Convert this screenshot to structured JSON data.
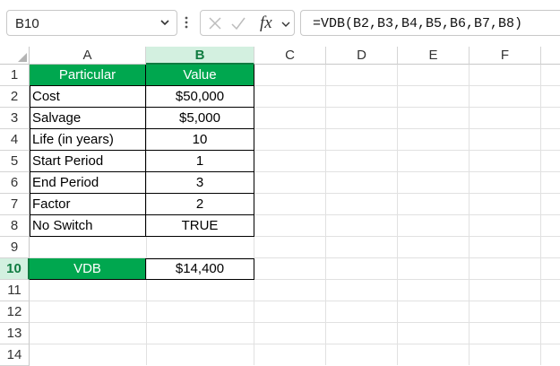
{
  "formula_bar": {
    "name_box": "B10",
    "fx_label": "fx",
    "formula": "=VDB(B2,B3,B4,B5,B6,B7,B8)"
  },
  "columns": [
    "A",
    "B",
    "C",
    "D",
    "E",
    "F"
  ],
  "rows": [
    "1",
    "2",
    "3",
    "4",
    "5",
    "6",
    "7",
    "8",
    "9",
    "10",
    "11",
    "12",
    "13",
    "14"
  ],
  "table": {
    "header": [
      "Particular",
      "Value"
    ],
    "rows": [
      [
        "Cost",
        "$50,000"
      ],
      [
        "Salvage",
        "$5,000"
      ],
      [
        "Life (in years)",
        "10"
      ],
      [
        "Start Period",
        "1"
      ],
      [
        "End Period",
        "3"
      ],
      [
        "Factor",
        "2"
      ],
      [
        "No Switch",
        "TRUE"
      ]
    ],
    "result_label": "VDB",
    "result_value": "$14,400"
  },
  "colors": {
    "header_fill": "#00a74f",
    "header_text": "#ffffff",
    "selection": "#107c41"
  },
  "icons": [
    "chevron-down-icon",
    "more-options-icon",
    "cancel-icon",
    "enter-icon",
    "insert-function-icon"
  ]
}
